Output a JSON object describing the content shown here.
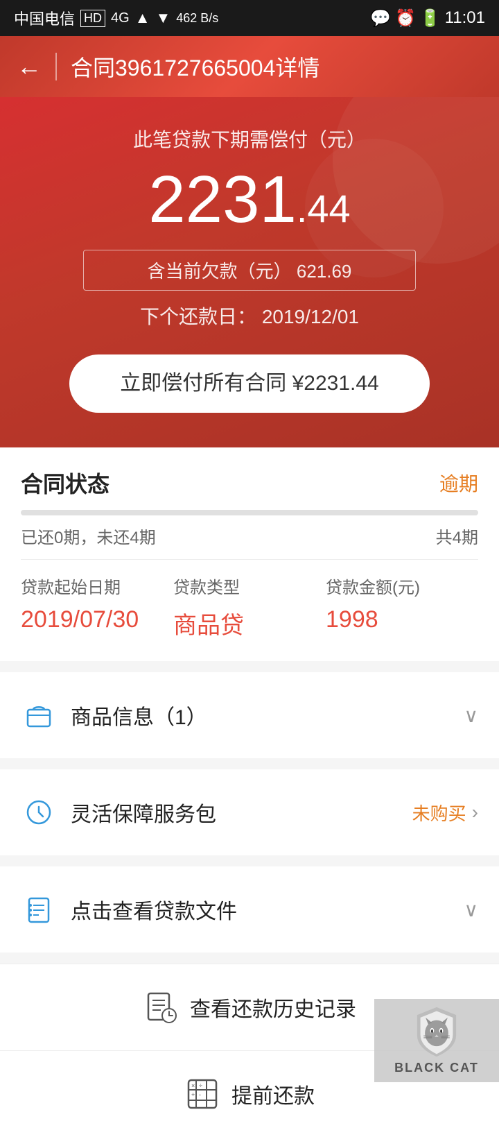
{
  "statusBar": {
    "carrier": "中国电信",
    "hd": "HD",
    "network": "4G",
    "speed": "462 B/s",
    "time": "11:01",
    "battery": "■"
  },
  "header": {
    "back_label": "←",
    "title": "合同3961727665004详情"
  },
  "hero": {
    "subtitle": "此笔贷款下期需偿付（元）",
    "amount_int": "2231",
    "amount_dec": ".44",
    "overdue_label": "含当前欠款（元）",
    "overdue_amount": "621.69",
    "next_date_label": "下个还款日：",
    "next_date": "2019/12/01",
    "pay_btn_label": "立即偿付所有合同 ¥2231.44"
  },
  "contractStatus": {
    "title": "合同状态",
    "status": "逾期",
    "paid_label": "已还0期，未还4期",
    "total_label": "共4期",
    "progress": 0
  },
  "loanInfo": {
    "start_date_label": "贷款起始日期",
    "start_date_value": "2019/07/30",
    "type_label": "贷款类型",
    "type_value": "商品贷",
    "amount_label": "贷款金额(元)",
    "amount_value": "1998"
  },
  "productInfo": {
    "icon": "🛍",
    "label": "商品信息（1）",
    "chevron": "∨"
  },
  "servicePackage": {
    "icon": "⟳",
    "label": "灵活保障服务包",
    "status": "未购买",
    "chevron": "›"
  },
  "loanDocs": {
    "icon": "📋",
    "label": "点击查看贷款文件",
    "chevron": "∨"
  },
  "bottomActions": {
    "history": {
      "icon": "📋",
      "label": "查看还款历史记录"
    },
    "early": {
      "icon": "🔢",
      "label": "提前还款"
    }
  },
  "blackCat": {
    "text": "BLACK CAT"
  }
}
